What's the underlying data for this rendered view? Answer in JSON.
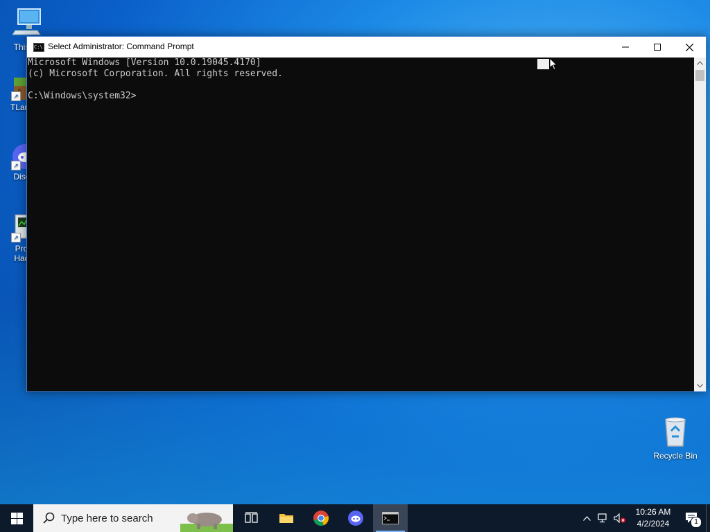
{
  "desktop": {
    "icons": [
      {
        "label": "This"
      },
      {
        "label": "TLaun"
      },
      {
        "label": "Disc"
      },
      {
        "label": "Pro\nHac"
      },
      {
        "label": "Recycle Bin"
      }
    ]
  },
  "window": {
    "title": "Select Administrator: Command Prompt",
    "console_lines": [
      "Microsoft Windows [Version 10.0.19045.4170]",
      "(c) Microsoft Corporation. All rights reserved.",
      "",
      "C:\\Windows\\system32>"
    ],
    "controls": {
      "minimize": "—",
      "maximize": "☐",
      "close": "✕"
    }
  },
  "taskbar": {
    "search_placeholder": "Type here to search",
    "apps": [
      "task-view",
      "file-explorer",
      "chrome",
      "discord",
      "command-prompt"
    ],
    "active_app": "command-prompt"
  },
  "tray": {
    "time": "10:26 AM",
    "date": "4/2/2024",
    "notification_count": "1"
  },
  "colors": {
    "accent": "#0078d7",
    "console_bg": "#0c0c0c",
    "console_fg": "#cccccc",
    "taskbar_bg": "#0d1a2b"
  }
}
